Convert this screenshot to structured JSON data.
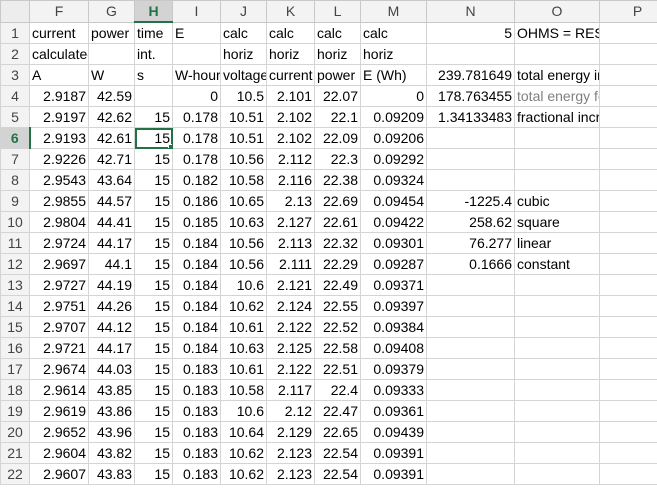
{
  "columns": [
    "F",
    "G",
    "H",
    "I",
    "J",
    "K",
    "L",
    "M",
    "N",
    "O",
    "P"
  ],
  "selected_column": "H",
  "selected_row": 6,
  "rows": [
    {
      "n": "1",
      "F": "current",
      "G": "power",
      "H": "time",
      "I": "E",
      "J": "calc",
      "K": "calc",
      "L": "calc",
      "M": "calc",
      "N": "5",
      "O": "OHMS = RESISTANCE OF",
      "P": ""
    },
    {
      "n": "2",
      "F": "calculated",
      "G": "",
      "H": "int.",
      "I": "",
      "J": "horiz",
      "K": "horiz",
      "L": "horiz",
      "M": "horiz",
      "N": "",
      "O": "",
      "P": ""
    },
    {
      "n": "3",
      "F": "A",
      "G": "W",
      "H": "s",
      "I": "W-hours",
      "J": "voltage",
      "K": "current",
      "L": "power",
      "M": "E (Wh)",
      "N": "239.781649",
      "O": "total energy in Wh",
      "P": ""
    },
    {
      "n": "4",
      "F": "2.9187",
      "G": "42.59",
      "H": "",
      "I": "0",
      "J": "10.5",
      "K": "2.101",
      "L": "22.07",
      "M": "0",
      "N": "178.763455",
      "O": "total energy for fixed c",
      "P": ""
    },
    {
      "n": "5",
      "F": "2.9197",
      "G": "42.62",
      "H": "15",
      "I": "0.178",
      "J": "10.51",
      "K": "2.102",
      "L": "22.1",
      "M": "0.09209",
      "N": "1.34133483",
      "O": "fractional increase",
      "P": ""
    },
    {
      "n": "6",
      "F": "2.9193",
      "G": "42.61",
      "H": "15",
      "I": "0.178",
      "J": "10.51",
      "K": "2.102",
      "L": "22.09",
      "M": "0.09206",
      "N": "",
      "O": "",
      "P": ""
    },
    {
      "n": "7",
      "F": "2.9226",
      "G": "42.71",
      "H": "15",
      "I": "0.178",
      "J": "10.56",
      "K": "2.112",
      "L": "22.3",
      "M": "0.09292",
      "N": "",
      "O": "",
      "P": ""
    },
    {
      "n": "8",
      "F": "2.9543",
      "G": "43.64",
      "H": "15",
      "I": "0.182",
      "J": "10.58",
      "K": "2.116",
      "L": "22.38",
      "M": "0.09324",
      "N": "",
      "O": "",
      "P": ""
    },
    {
      "n": "9",
      "F": "2.9855",
      "G": "44.57",
      "H": "15",
      "I": "0.186",
      "J": "10.65",
      "K": "2.13",
      "L": "22.69",
      "M": "0.09454",
      "N": "-1225.4",
      "O": "cubic",
      "P": ""
    },
    {
      "n": "10",
      "F": "2.9804",
      "G": "44.41",
      "H": "15",
      "I": "0.185",
      "J": "10.63",
      "K": "2.127",
      "L": "22.61",
      "M": "0.09422",
      "N": "258.62",
      "O": "square",
      "P": ""
    },
    {
      "n": "11",
      "F": "2.9724",
      "G": "44.17",
      "H": "15",
      "I": "0.184",
      "J": "10.56",
      "K": "2.113",
      "L": "22.32",
      "M": "0.09301",
      "N": "76.277",
      "O": "linear",
      "P": ""
    },
    {
      "n": "12",
      "F": "2.9697",
      "G": "44.1",
      "H": "15",
      "I": "0.184",
      "J": "10.56",
      "K": "2.111",
      "L": "22.29",
      "M": "0.09287",
      "N": "0.1666",
      "O": "constant",
      "P": ""
    },
    {
      "n": "13",
      "F": "2.9727",
      "G": "44.19",
      "H": "15",
      "I": "0.184",
      "J": "10.6",
      "K": "2.121",
      "L": "22.49",
      "M": "0.09371",
      "N": "",
      "O": "",
      "P": ""
    },
    {
      "n": "14",
      "F": "2.9751",
      "G": "44.26",
      "H": "15",
      "I": "0.184",
      "J": "10.62",
      "K": "2.124",
      "L": "22.55",
      "M": "0.09397",
      "N": "",
      "O": "",
      "P": ""
    },
    {
      "n": "15",
      "F": "2.9707",
      "G": "44.12",
      "H": "15",
      "I": "0.184",
      "J": "10.61",
      "K": "2.122",
      "L": "22.52",
      "M": "0.09384",
      "N": "",
      "O": "",
      "P": ""
    },
    {
      "n": "16",
      "F": "2.9721",
      "G": "44.17",
      "H": "15",
      "I": "0.184",
      "J": "10.63",
      "K": "2.125",
      "L": "22.58",
      "M": "0.09408",
      "N": "",
      "O": "",
      "P": ""
    },
    {
      "n": "17",
      "F": "2.9674",
      "G": "44.03",
      "H": "15",
      "I": "0.183",
      "J": "10.61",
      "K": "2.122",
      "L": "22.51",
      "M": "0.09379",
      "N": "",
      "O": "",
      "P": ""
    },
    {
      "n": "18",
      "F": "2.9614",
      "G": "43.85",
      "H": "15",
      "I": "0.183",
      "J": "10.58",
      "K": "2.117",
      "L": "22.4",
      "M": "0.09333",
      "N": "",
      "O": "",
      "P": ""
    },
    {
      "n": "19",
      "F": "2.9619",
      "G": "43.86",
      "H": "15",
      "I": "0.183",
      "J": "10.6",
      "K": "2.12",
      "L": "22.47",
      "M": "0.09361",
      "N": "",
      "O": "",
      "P": ""
    },
    {
      "n": "20",
      "F": "2.9652",
      "G": "43.96",
      "H": "15",
      "I": "0.183",
      "J": "10.64",
      "K": "2.129",
      "L": "22.65",
      "M": "0.09439",
      "N": "",
      "O": "",
      "P": ""
    },
    {
      "n": "21",
      "F": "2.9604",
      "G": "43.82",
      "H": "15",
      "I": "0.183",
      "J": "10.62",
      "K": "2.123",
      "L": "22.54",
      "M": "0.09391",
      "N": "",
      "O": "",
      "P": ""
    },
    {
      "n": "22",
      "F": "2.9607",
      "G": "43.83",
      "H": "15",
      "I": "0.183",
      "J": "10.62",
      "K": "2.123",
      "L": "22.54",
      "M": "0.09391",
      "N": "",
      "O": "",
      "P": ""
    }
  ],
  "colors": {
    "accent": "#217346",
    "gridline": "#d4d4d4",
    "header_bg": "#f3f3f3",
    "muted_text": "#7f7f7f"
  }
}
